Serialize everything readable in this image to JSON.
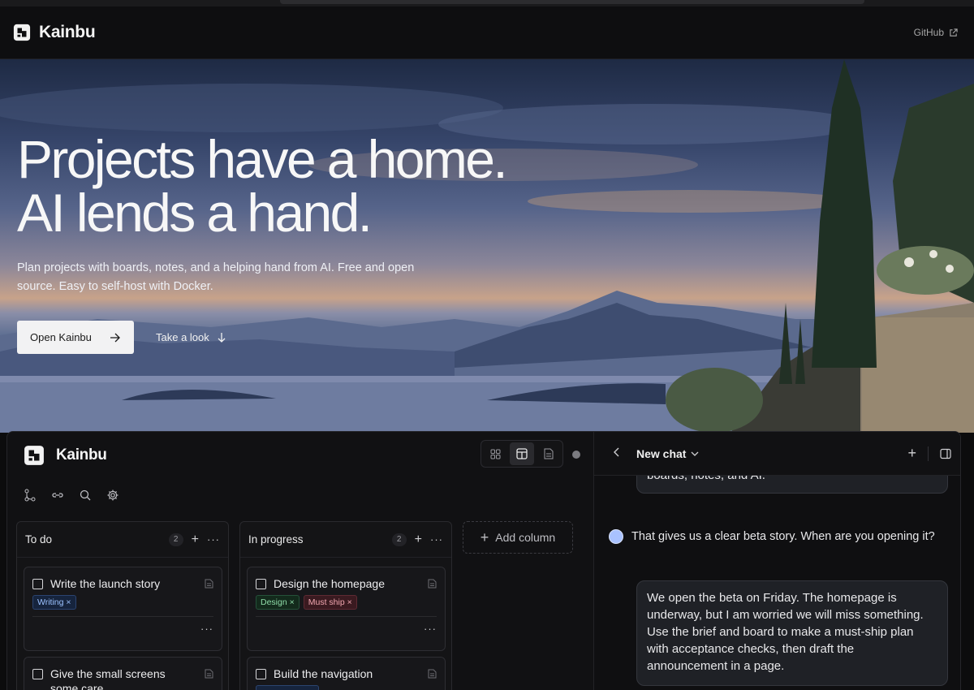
{
  "site": {
    "brand": "Kainbu",
    "github_label": "GitHub"
  },
  "hero": {
    "title_line1": "Projects have a home.",
    "title_line2": "AI lends a hand.",
    "subtitle": "Plan projects with boards, notes, and a helping hand from AI. Free and open source. Easy to self-host with Docker.",
    "primary_cta": "Open Kainbu",
    "secondary_cta": "Take a look"
  },
  "app": {
    "brand": "Kainbu",
    "columns": [
      {
        "title": "To do",
        "count": "2",
        "cards": [
          {
            "title": "Write the launch story",
            "tags": [
              "Writing ×"
            ]
          },
          {
            "title": "Give the small screens",
            "subtitle": "some care"
          }
        ]
      },
      {
        "title": "In progress",
        "count": "2",
        "cards": [
          {
            "title": "Design the homepage",
            "tags": [
              "Design ×",
              "Must ship ×"
            ]
          },
          {
            "title": "Build the navigation"
          }
        ]
      }
    ],
    "add_column": "Add column",
    "more_glyph": "···"
  },
  "chat": {
    "title": "New chat",
    "prev_message_tail": "boards, notes, and AI.",
    "ai_message": "That gives us a clear beta story. When are you opening it?",
    "user_message": "We open the beta on Friday. The homepage is underway, but I am worried we will miss something. Use the brief and board to make a must-ship plan with acceptance checks, then draft the announcement in a page."
  },
  "colors": {
    "accent_ai": "#a9c2ff",
    "tag_blue": "#9cc2ff",
    "tag_green": "#8fdca8",
    "tag_red": "#f1a6b0"
  }
}
